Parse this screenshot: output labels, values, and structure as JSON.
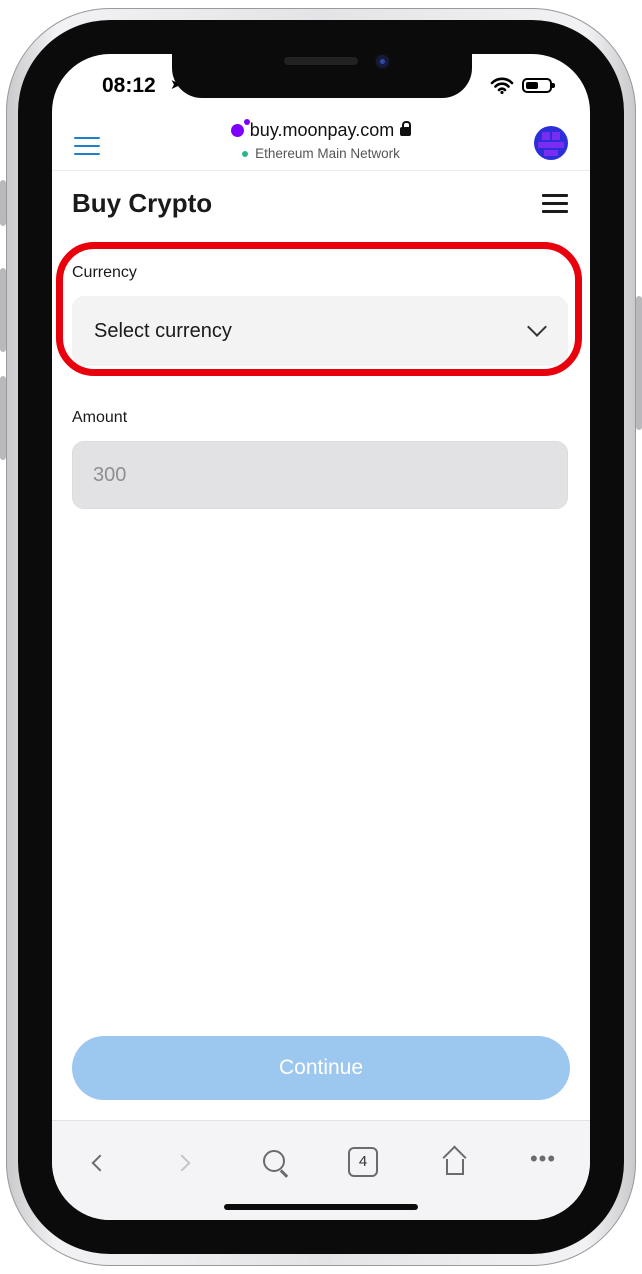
{
  "status_bar": {
    "time": "08:12"
  },
  "browser": {
    "url": "buy.moonpay.com",
    "network": "Ethereum Main Network",
    "tab_count": "4"
  },
  "page": {
    "title": "Buy Crypto",
    "currency": {
      "label": "Currency",
      "placeholder": "Select currency"
    },
    "amount": {
      "label": "Amount",
      "value": "300"
    },
    "continue_label": "Continue"
  },
  "colors": {
    "highlight": "#e8000c",
    "continue_disabled": "#9cc7ef",
    "moonpay_brand": "#7d00ff",
    "network_dot": "#2ab785",
    "menu_blue": "#1d80c8"
  }
}
